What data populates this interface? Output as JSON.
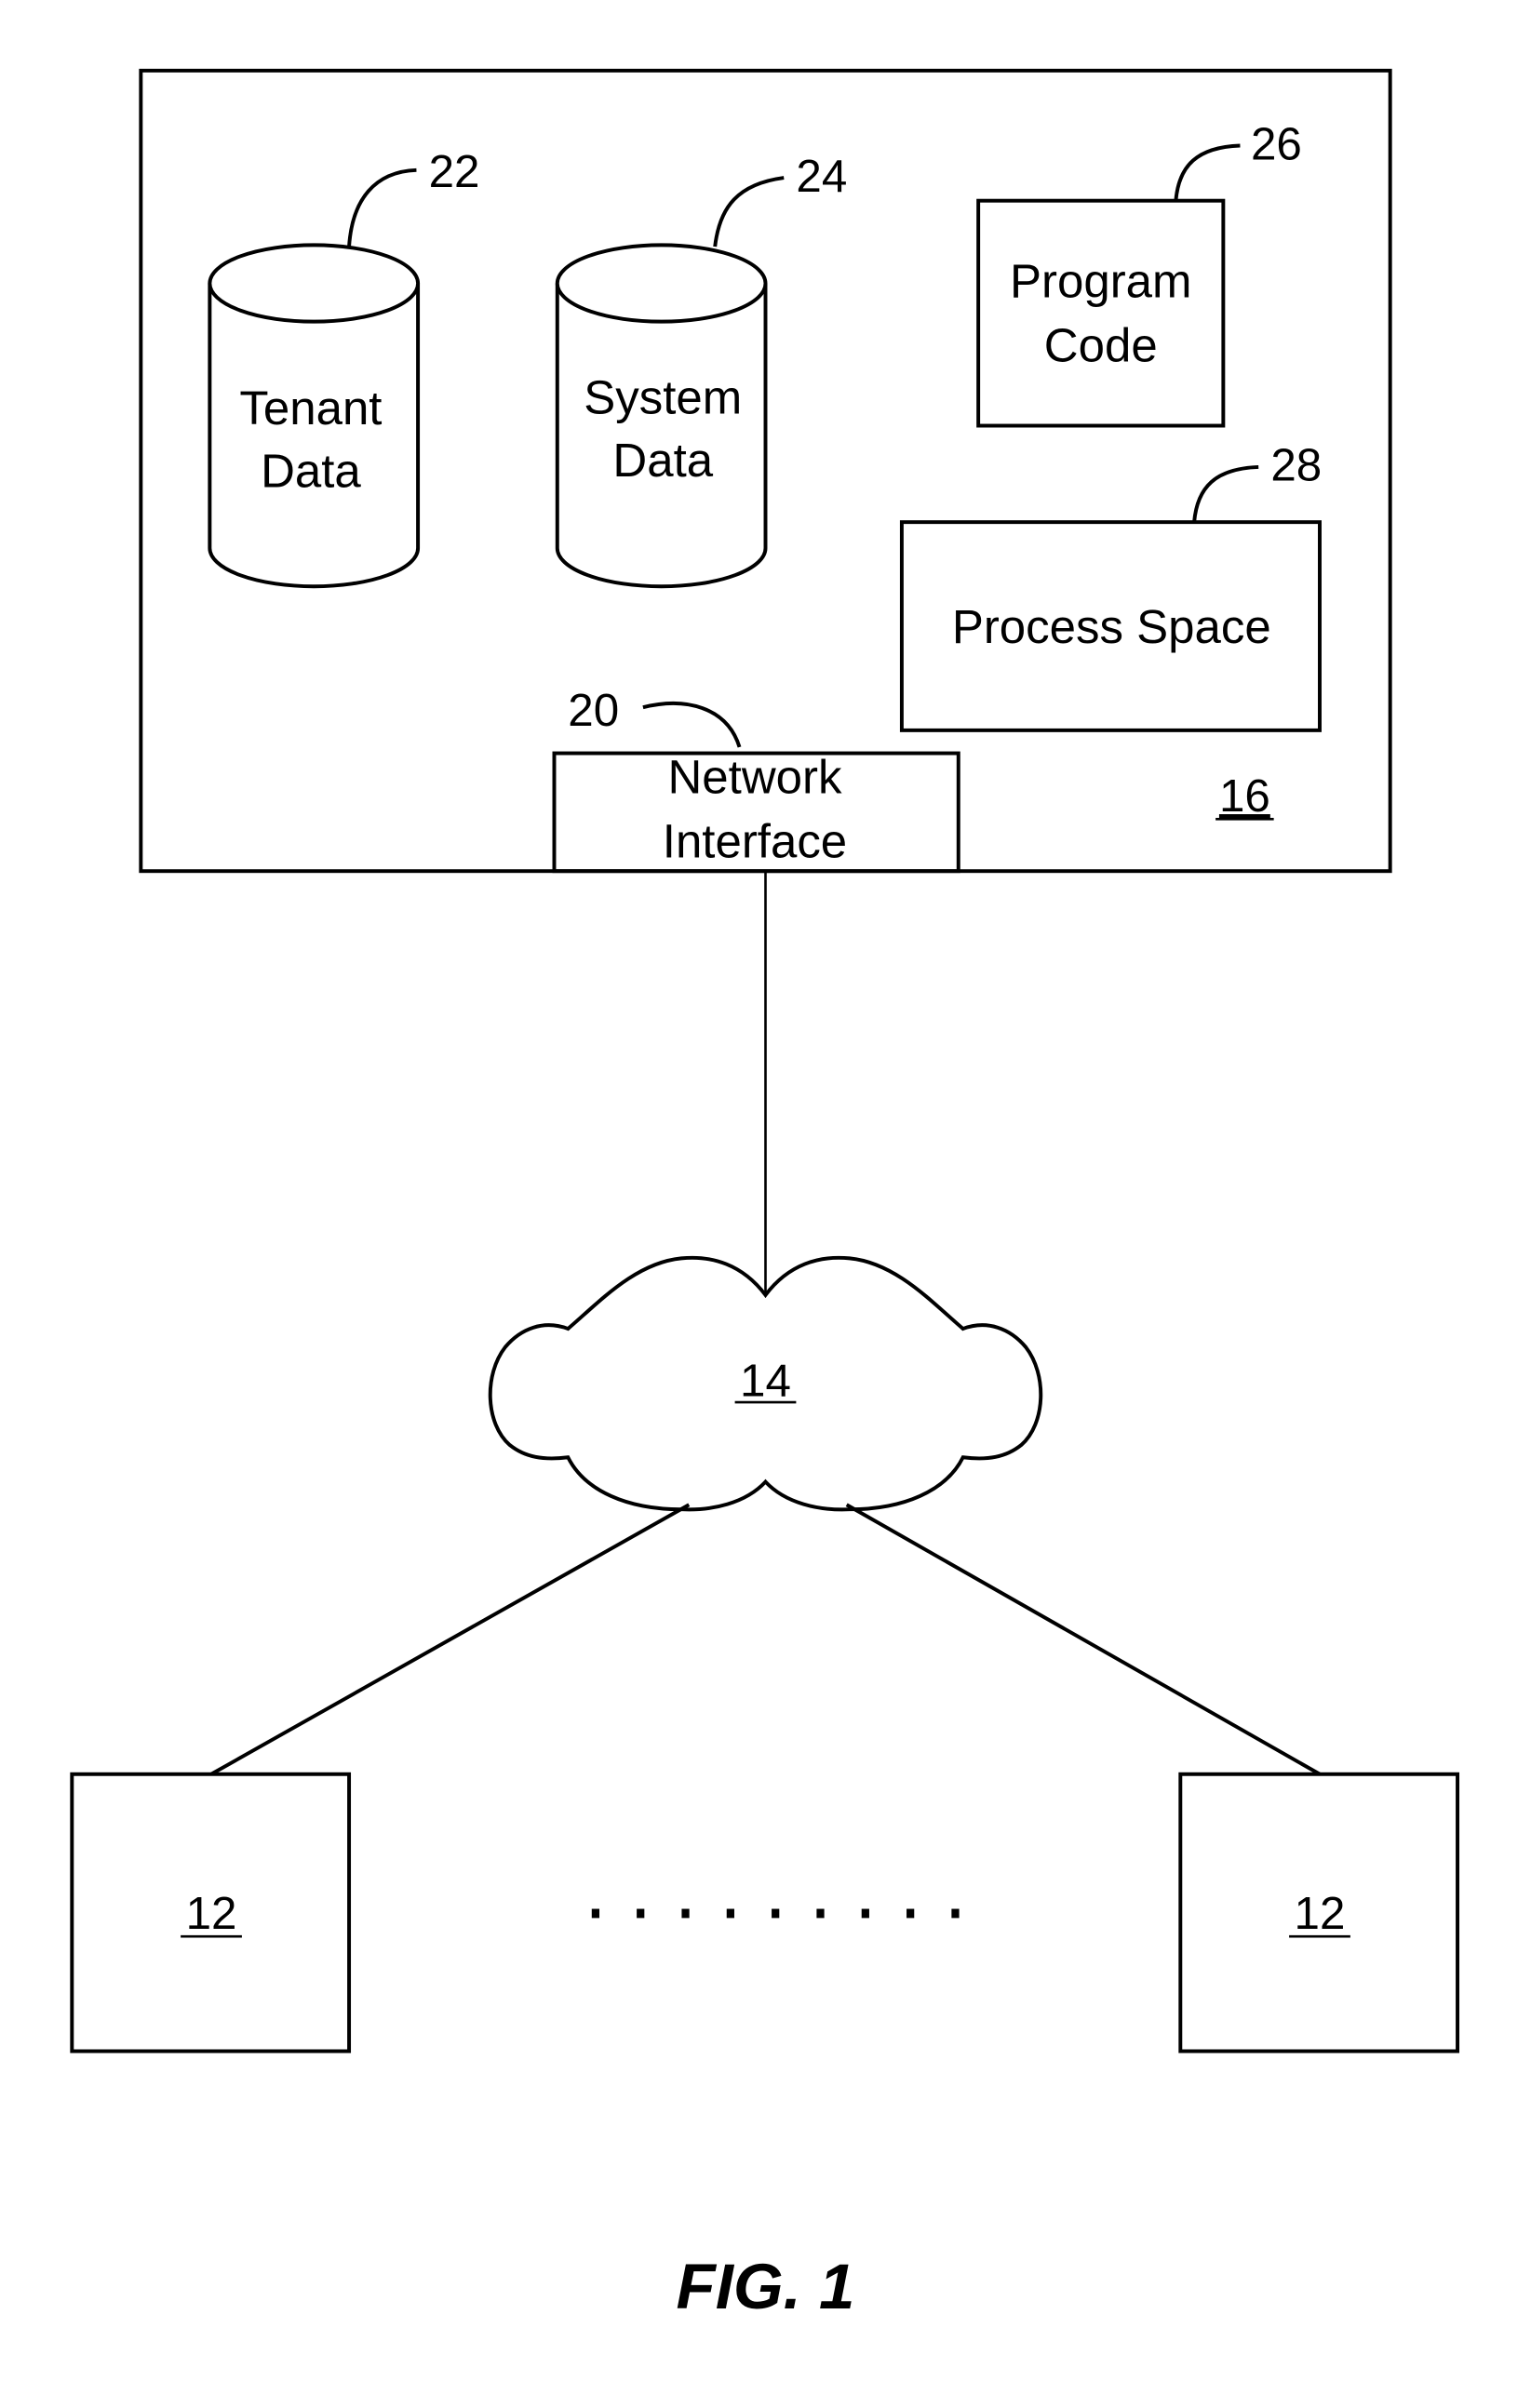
{
  "figure": {
    "caption": "FIG. 1",
    "system": {
      "ref": "16",
      "tenant_data": {
        "line1": "Tenant",
        "line2": "Data",
        "ref": "22"
      },
      "system_data": {
        "line1": "System",
        "line2": "Data",
        "ref": "24"
      },
      "program_code": {
        "line1": "Program",
        "line2": "Code",
        "ref": "26"
      },
      "process_space": {
        "label": "Process Space",
        "ref": "28"
      },
      "network_interface": {
        "line1": "Network",
        "line2": "Interface",
        "ref": "20"
      }
    },
    "network": {
      "ref": "14"
    },
    "clients": [
      {
        "ref": "12"
      },
      {
        "ref": "12"
      }
    ],
    "ellipsis_dot_count": 9
  }
}
